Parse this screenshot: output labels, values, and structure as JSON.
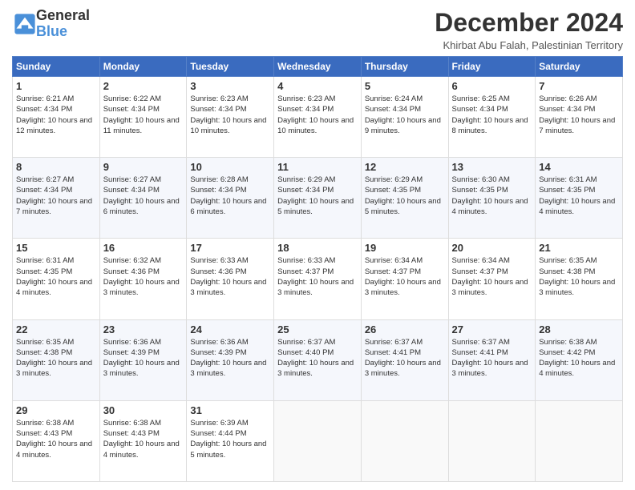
{
  "header": {
    "logo_line1": "General",
    "logo_line2": "Blue",
    "month_title": "December 2024",
    "location": "Khirbat Abu Falah, Palestinian Territory"
  },
  "days_of_week": [
    "Sunday",
    "Monday",
    "Tuesday",
    "Wednesday",
    "Thursday",
    "Friday",
    "Saturday"
  ],
  "weeks": [
    [
      {
        "day": "1",
        "info": "Sunrise: 6:21 AM\nSunset: 4:34 PM\nDaylight: 10 hours and 12 minutes."
      },
      {
        "day": "2",
        "info": "Sunrise: 6:22 AM\nSunset: 4:34 PM\nDaylight: 10 hours and 11 minutes."
      },
      {
        "day": "3",
        "info": "Sunrise: 6:23 AM\nSunset: 4:34 PM\nDaylight: 10 hours and 10 minutes."
      },
      {
        "day": "4",
        "info": "Sunrise: 6:23 AM\nSunset: 4:34 PM\nDaylight: 10 hours and 10 minutes."
      },
      {
        "day": "5",
        "info": "Sunrise: 6:24 AM\nSunset: 4:34 PM\nDaylight: 10 hours and 9 minutes."
      },
      {
        "day": "6",
        "info": "Sunrise: 6:25 AM\nSunset: 4:34 PM\nDaylight: 10 hours and 8 minutes."
      },
      {
        "day": "7",
        "info": "Sunrise: 6:26 AM\nSunset: 4:34 PM\nDaylight: 10 hours and 7 minutes."
      }
    ],
    [
      {
        "day": "8",
        "info": "Sunrise: 6:27 AM\nSunset: 4:34 PM\nDaylight: 10 hours and 7 minutes."
      },
      {
        "day": "9",
        "info": "Sunrise: 6:27 AM\nSunset: 4:34 PM\nDaylight: 10 hours and 6 minutes."
      },
      {
        "day": "10",
        "info": "Sunrise: 6:28 AM\nSunset: 4:34 PM\nDaylight: 10 hours and 6 minutes."
      },
      {
        "day": "11",
        "info": "Sunrise: 6:29 AM\nSunset: 4:34 PM\nDaylight: 10 hours and 5 minutes."
      },
      {
        "day": "12",
        "info": "Sunrise: 6:29 AM\nSunset: 4:35 PM\nDaylight: 10 hours and 5 minutes."
      },
      {
        "day": "13",
        "info": "Sunrise: 6:30 AM\nSunset: 4:35 PM\nDaylight: 10 hours and 4 minutes."
      },
      {
        "day": "14",
        "info": "Sunrise: 6:31 AM\nSunset: 4:35 PM\nDaylight: 10 hours and 4 minutes."
      }
    ],
    [
      {
        "day": "15",
        "info": "Sunrise: 6:31 AM\nSunset: 4:35 PM\nDaylight: 10 hours and 4 minutes."
      },
      {
        "day": "16",
        "info": "Sunrise: 6:32 AM\nSunset: 4:36 PM\nDaylight: 10 hours and 3 minutes."
      },
      {
        "day": "17",
        "info": "Sunrise: 6:33 AM\nSunset: 4:36 PM\nDaylight: 10 hours and 3 minutes."
      },
      {
        "day": "18",
        "info": "Sunrise: 6:33 AM\nSunset: 4:37 PM\nDaylight: 10 hours and 3 minutes."
      },
      {
        "day": "19",
        "info": "Sunrise: 6:34 AM\nSunset: 4:37 PM\nDaylight: 10 hours and 3 minutes."
      },
      {
        "day": "20",
        "info": "Sunrise: 6:34 AM\nSunset: 4:37 PM\nDaylight: 10 hours and 3 minutes."
      },
      {
        "day": "21",
        "info": "Sunrise: 6:35 AM\nSunset: 4:38 PM\nDaylight: 10 hours and 3 minutes."
      }
    ],
    [
      {
        "day": "22",
        "info": "Sunrise: 6:35 AM\nSunset: 4:38 PM\nDaylight: 10 hours and 3 minutes."
      },
      {
        "day": "23",
        "info": "Sunrise: 6:36 AM\nSunset: 4:39 PM\nDaylight: 10 hours and 3 minutes."
      },
      {
        "day": "24",
        "info": "Sunrise: 6:36 AM\nSunset: 4:39 PM\nDaylight: 10 hours and 3 minutes."
      },
      {
        "day": "25",
        "info": "Sunrise: 6:37 AM\nSunset: 4:40 PM\nDaylight: 10 hours and 3 minutes."
      },
      {
        "day": "26",
        "info": "Sunrise: 6:37 AM\nSunset: 4:41 PM\nDaylight: 10 hours and 3 minutes."
      },
      {
        "day": "27",
        "info": "Sunrise: 6:37 AM\nSunset: 4:41 PM\nDaylight: 10 hours and 3 minutes."
      },
      {
        "day": "28",
        "info": "Sunrise: 6:38 AM\nSunset: 4:42 PM\nDaylight: 10 hours and 4 minutes."
      }
    ],
    [
      {
        "day": "29",
        "info": "Sunrise: 6:38 AM\nSunset: 4:43 PM\nDaylight: 10 hours and 4 minutes."
      },
      {
        "day": "30",
        "info": "Sunrise: 6:38 AM\nSunset: 4:43 PM\nDaylight: 10 hours and 4 minutes."
      },
      {
        "day": "31",
        "info": "Sunrise: 6:39 AM\nSunset: 4:44 PM\nDaylight: 10 hours and 5 minutes."
      },
      {
        "day": "",
        "info": ""
      },
      {
        "day": "",
        "info": ""
      },
      {
        "day": "",
        "info": ""
      },
      {
        "day": "",
        "info": ""
      }
    ]
  ]
}
